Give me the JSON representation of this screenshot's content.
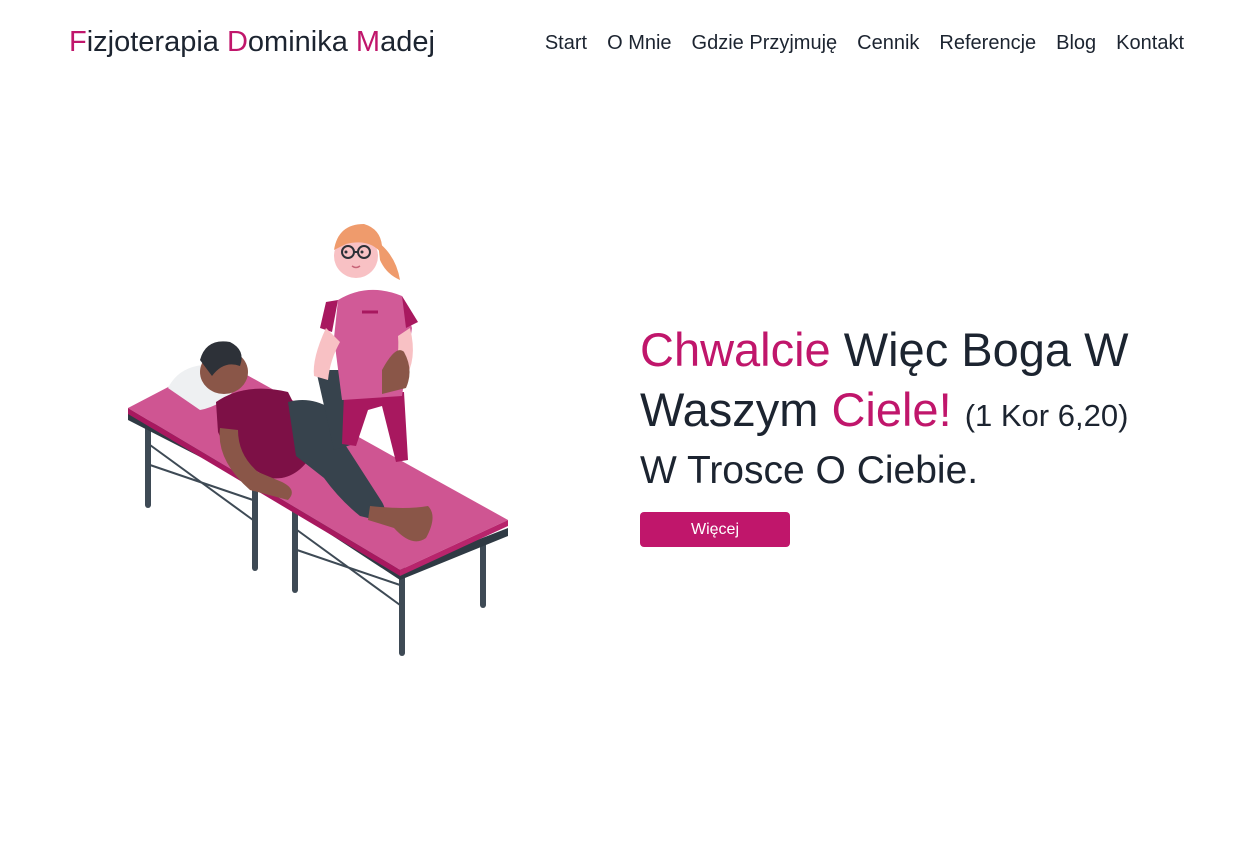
{
  "brand": {
    "parts": [
      {
        "letter": "F",
        "rest": "izjoterapia "
      },
      {
        "letter": "D",
        "rest": "ominika "
      },
      {
        "letter": "M",
        "rest": "adej"
      }
    ]
  },
  "nav": {
    "items": [
      "Start",
      "O Mnie",
      "Gdzie Przyjmuję",
      "Cennik",
      "Referencje",
      "Blog",
      "Kontakt"
    ]
  },
  "hero": {
    "headline_accent_1": "Chwalcie",
    "headline_mid": " Więc Boga W Waszym ",
    "headline_accent_2": "Ciele!",
    "verse_ref": "(1 Kor 6,20)",
    "subheadline": "W Trosce O Ciebie.",
    "button_label": "Więcej"
  },
  "illustration": {
    "icon": "physiotherapy-illustration"
  },
  "colors": {
    "accent": "#c0166b",
    "text": "#1c2430",
    "background": "#ffffff"
  }
}
